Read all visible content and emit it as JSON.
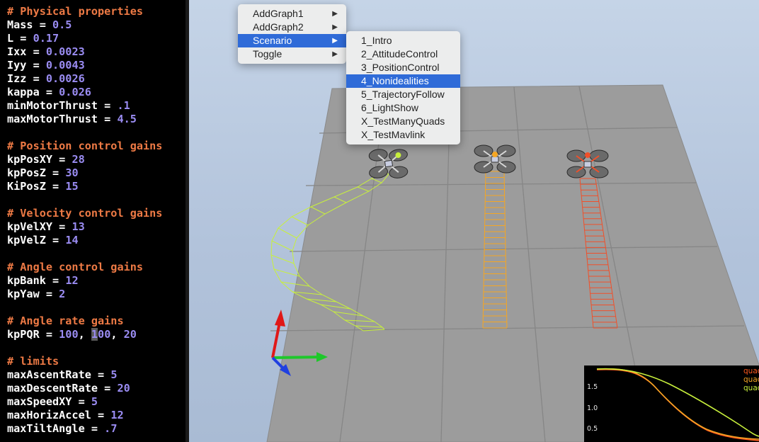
{
  "editor": {
    "lines": [
      {
        "type": "comment",
        "text": "# Physical properties"
      },
      {
        "type": "kv",
        "key": "Mass",
        "value": "0.5"
      },
      {
        "type": "kv",
        "key": "L",
        "value": "0.17"
      },
      {
        "type": "kv",
        "key": "Ixx",
        "value": "0.0023"
      },
      {
        "type": "kv",
        "key": "Iyy",
        "value": "0.0043"
      },
      {
        "type": "kv",
        "key": "Izz",
        "value": "0.0026"
      },
      {
        "type": "kv",
        "key": "kappa",
        "value": "0.026"
      },
      {
        "type": "kv",
        "key": "minMotorThrust",
        "value": ".1"
      },
      {
        "type": "kv",
        "key": "maxMotorThrust",
        "value": "4.5"
      },
      {
        "type": "blank"
      },
      {
        "type": "comment",
        "text": "# Position control gains"
      },
      {
        "type": "kv",
        "key": "kpPosXY",
        "value": "28"
      },
      {
        "type": "kv",
        "key": "kpPosZ",
        "value": "30"
      },
      {
        "type": "kv",
        "key": "KiPosZ",
        "value": "15"
      },
      {
        "type": "blank"
      },
      {
        "type": "comment",
        "text": "# Velocity control gains"
      },
      {
        "type": "kv",
        "key": "kpVelXY",
        "value": "13"
      },
      {
        "type": "kv",
        "key": "kpVelZ",
        "value": "14"
      },
      {
        "type": "blank"
      },
      {
        "type": "comment",
        "text": "# Angle control gains"
      },
      {
        "type": "kv",
        "key": "kpBank",
        "value": "12"
      },
      {
        "type": "kv",
        "key": "kpYaw",
        "value": "2"
      },
      {
        "type": "blank"
      },
      {
        "type": "comment",
        "text": "# Angle rate gains"
      },
      {
        "type": "kvlist",
        "key": "kpPQR",
        "values": [
          "100",
          "100",
          "20"
        ],
        "cursor_value_index": 1
      },
      {
        "type": "blank"
      },
      {
        "type": "comment",
        "text": "# limits"
      },
      {
        "type": "kv",
        "key": "maxAscentRate",
        "value": "5"
      },
      {
        "type": "kv",
        "key": "maxDescentRate",
        "value": "20"
      },
      {
        "type": "kv",
        "key": "maxSpeedXY",
        "value": "5"
      },
      {
        "type": "kv",
        "key": "maxHorizAccel",
        "value": "12"
      },
      {
        "type": "kv",
        "key": "maxTiltAngle",
        "value": ".7"
      }
    ]
  },
  "menu": {
    "items": [
      {
        "label": "AddGraph1",
        "has_submenu": true,
        "active": false
      },
      {
        "label": "AddGraph2",
        "has_submenu": true,
        "active": false
      },
      {
        "label": "Scenario",
        "has_submenu": true,
        "active": true
      },
      {
        "label": "Toggle",
        "has_submenu": true,
        "active": false
      }
    ],
    "scenario_submenu": [
      {
        "label": "1_Intro",
        "active": false
      },
      {
        "label": "2_AttitudeControl",
        "active": false
      },
      {
        "label": "3_PositionControl",
        "active": false
      },
      {
        "label": "4_Nonidealities",
        "active": true
      },
      {
        "label": "5_TrajectoryFollow",
        "active": false
      },
      {
        "label": "6_LightShow",
        "active": false
      },
      {
        "label": "X_TestManyQuads",
        "active": false
      },
      {
        "label": "X_TestMavlink",
        "active": false
      }
    ]
  },
  "colors": {
    "trail_green": "#c8f03c",
    "trail_orange": "#f5a623",
    "trail_red": "#f0502a",
    "axis_x": "#1ec82a",
    "axis_y": "#e01818",
    "axis_z": "#2040e0",
    "menu_highlight": "#2f6bd8"
  },
  "graph": {
    "y_ticks": [
      "1.5",
      "1.0",
      "0.5"
    ],
    "legend": [
      {
        "label": "quad",
        "color": "#ff5a1e"
      },
      {
        "label": "quad",
        "color": "#f5a623"
      },
      {
        "label": "quad",
        "color": "#c8f03c"
      }
    ]
  }
}
